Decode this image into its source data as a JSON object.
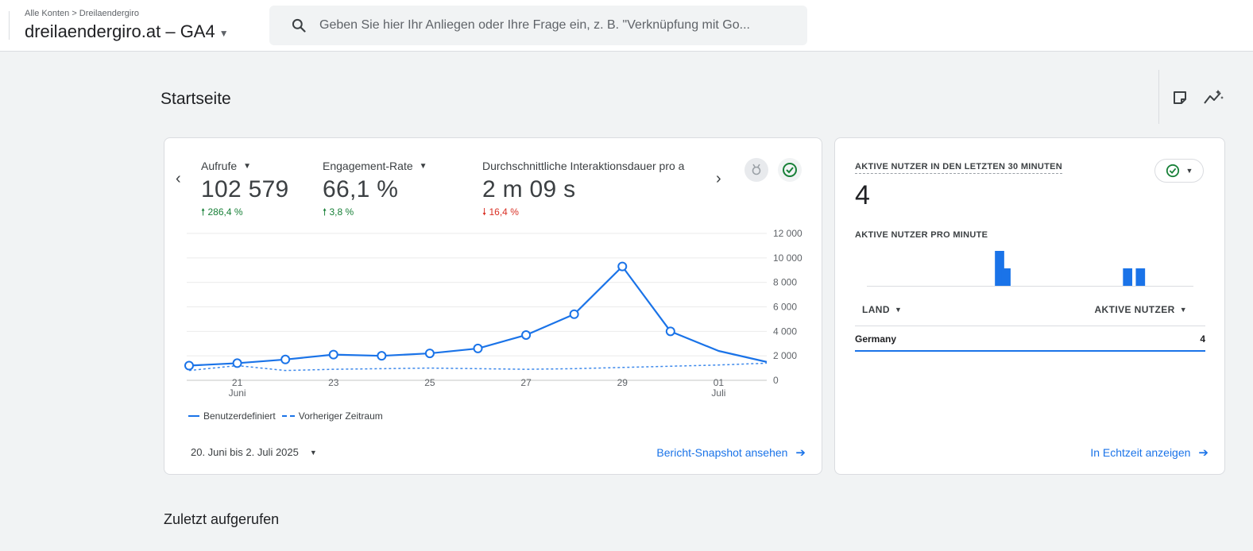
{
  "header": {
    "breadcrumb": "Alle Konten > Dreilaendergiro",
    "property_name": "dreilaendergiro.at",
    "property_suffix": " – GA4",
    "search_placeholder": "Geben Sie hier Ihr Anliegen oder Ihre Frage ein, z. B. \"Verknüpfung mit Go..."
  },
  "page": {
    "title": "Startseite",
    "tools": [
      "notes-icon",
      "insights-icon"
    ]
  },
  "overview": {
    "metrics": [
      {
        "label": "Aufrufe",
        "value": "102 579",
        "change": "286,4 %",
        "direction": "up"
      },
      {
        "label": "Engagement-Rate",
        "value": "66,1 %",
        "change": "3,8 %",
        "direction": "up"
      },
      {
        "label": "Durchschnittliche Interaktionsdauer pro a",
        "value": "2 m 09 s",
        "change": "16,4 %",
        "direction": "down"
      }
    ],
    "legend": {
      "current": "Benutzerdefiniert",
      "previous": "Vorheriger Zeitraum"
    },
    "date_range": "20. Juni bis 2. Juli 2025",
    "link": "Bericht-Snapshot ansehen"
  },
  "chart_data": {
    "type": "line",
    "x": [
      "20.06",
      "21.06",
      "22.06",
      "23.06",
      "24.06",
      "25.06",
      "26.06",
      "27.06",
      "28.06",
      "29.06",
      "30.06",
      "01.07",
      "02.07"
    ],
    "x_tick_labels": [
      {
        "index": 1,
        "day": "21",
        "month": "Juni"
      },
      {
        "index": 3,
        "day": "23",
        "month": ""
      },
      {
        "index": 5,
        "day": "25",
        "month": ""
      },
      {
        "index": 7,
        "day": "27",
        "month": ""
      },
      {
        "index": 9,
        "day": "29",
        "month": ""
      },
      {
        "index": 11,
        "day": "01",
        "month": "Juli"
      }
    ],
    "y_ticks": [
      0,
      2000,
      4000,
      6000,
      8000,
      10000,
      12000
    ],
    "y_tick_labels": [
      "0",
      "2 000",
      "4 000",
      "6 000",
      "8 000",
      "10 000",
      "12 000"
    ],
    "ylim": [
      0,
      12000
    ],
    "grid": true,
    "series": [
      {
        "name": "Benutzerdefiniert",
        "style": "solid",
        "color": "#1a73e8",
        "values": [
          1200,
          1400,
          1700,
          2100,
          2000,
          2200,
          2600,
          3700,
          5400,
          9300,
          4000,
          2400,
          1500
        ],
        "markers": [
          true,
          true,
          true,
          true,
          true,
          true,
          true,
          true,
          true,
          true,
          true,
          false,
          false
        ]
      },
      {
        "name": "Vorheriger Zeitraum",
        "style": "dashed",
        "color": "#1a73e8",
        "values": [
          800,
          1200,
          800,
          900,
          950,
          1000,
          950,
          900,
          950,
          1050,
          1150,
          1250,
          1400
        ]
      }
    ]
  },
  "realtime": {
    "title": "AKTIVE NUTZER IN DEN LETZTEN 30 MINUTEN",
    "value": "4",
    "subtitle": "AKTIVE NUTZER PRO MINUTE",
    "per_minute": [
      0,
      0,
      0,
      0,
      0,
      0,
      0,
      0,
      0,
      0,
      0,
      0,
      0,
      0,
      0,
      0,
      0,
      0,
      0,
      0,
      2,
      1,
      0,
      0,
      0,
      0,
      0,
      0,
      0,
      0,
      0,
      0,
      0,
      0,
      0,
      0,
      0,
      0,
      0,
      0,
      1,
      0,
      1,
      0,
      0,
      0,
      0,
      0,
      0,
      0,
      0
    ],
    "table": {
      "col1": "LAND",
      "col2": "AKTIVE NUTZER",
      "rows": [
        {
          "country": "Germany",
          "users": "4"
        }
      ]
    },
    "link": "In Echtzeit anzeigen"
  },
  "recent": {
    "title": "Zuletzt aufgerufen"
  },
  "colors": {
    "accent": "#1a73e8",
    "up": "#188038",
    "down": "#d93025",
    "check": "#188038"
  }
}
